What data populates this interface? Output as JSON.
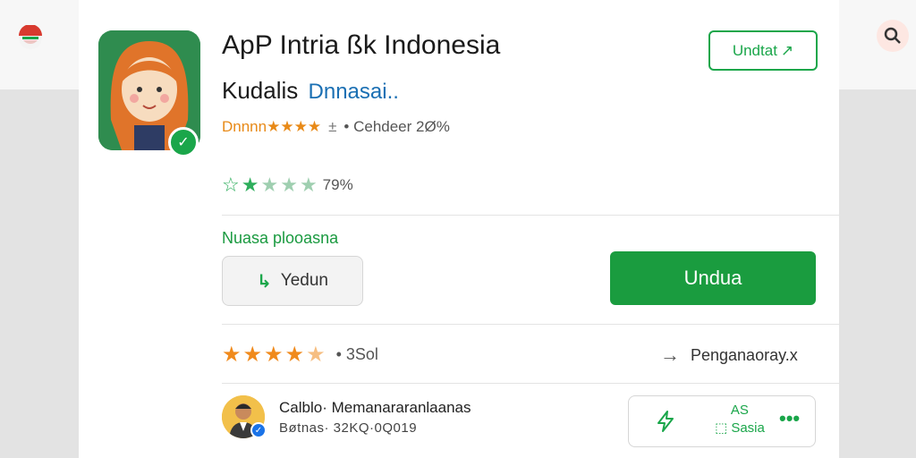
{
  "app": {
    "title": "ApP Intria ßk Indonesia",
    "developer": "Kudalis",
    "category": "Dnnasai..",
    "meta_rating": "Dnnnn★★★★",
    "meta_sep": "±",
    "meta_text": "• Cehdeer 2Ø%",
    "update_label": "Undtat",
    "update_icon": "↗"
  },
  "summary": {
    "stars": 1.5,
    "percent": "79%"
  },
  "install": {
    "section_label": "Nuasa plooasna",
    "secondary_label": "Yedun",
    "secondary_icon": "↳",
    "primary_label": "Undua"
  },
  "reviews": {
    "stars": 4.5,
    "count": "• 3Sol",
    "link_label": "Penganaoray.x",
    "link_icon": "→"
  },
  "user": {
    "name": "Calblo· Memanararanlaanas",
    "sub": "Bøtnas·  32KQ·0Q019",
    "action_icon": "ϟ",
    "action_label_1": "AS",
    "action_label_2": "⬚ Sasia",
    "more_icon": "•••"
  },
  "colors": {
    "brand_green": "#1a9c3f",
    "star_orange": "#f08a1c",
    "link_blue": "#1a6fb3"
  },
  "icons": {
    "search": "search-icon",
    "flag": "flag-icon",
    "verified": "verified-badge-icon"
  }
}
